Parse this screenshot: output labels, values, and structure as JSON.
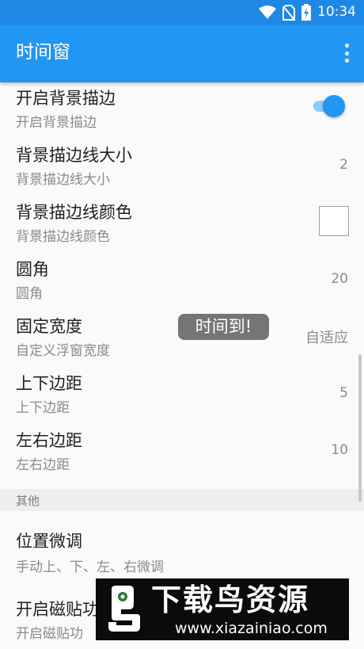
{
  "status_bar": {
    "time": "10:34"
  },
  "app_bar": {
    "title": "时间窗"
  },
  "prefs": [
    {
      "title": "开启背景描边",
      "summary": "开启背景描边",
      "switch_on": true
    },
    {
      "title": "背景描边线大小",
      "summary": "背景描边线大小",
      "value": "2"
    },
    {
      "title": "背景描边线颜色",
      "summary": "背景描边线颜色",
      "color": "#ffffff"
    },
    {
      "title": "圆角",
      "summary": "圆角",
      "value": "20"
    },
    {
      "title": "固定宽度",
      "summary": "自定义浮窗宽度",
      "value": "自适应"
    },
    {
      "title": "上下边距",
      "summary": "上下边距",
      "value": "5"
    },
    {
      "title": "左右边距",
      "summary": "左右边距",
      "value": "10"
    }
  ],
  "category": {
    "label": "其他"
  },
  "other_prefs": [
    {
      "title": "位置微调",
      "summary": "手动上、下、左、右微调"
    },
    {
      "title": "开启磁贴功",
      "summary": "开启磁贴功"
    }
  ],
  "toast": {
    "text": "时间到!"
  },
  "watermark": {
    "name": "下载鸟资源",
    "url": "www.xiazainiao.com"
  },
  "colors": {
    "status_bar": "#1e88e5",
    "app_bar": "#2196f3",
    "accent": "#2196f3"
  }
}
